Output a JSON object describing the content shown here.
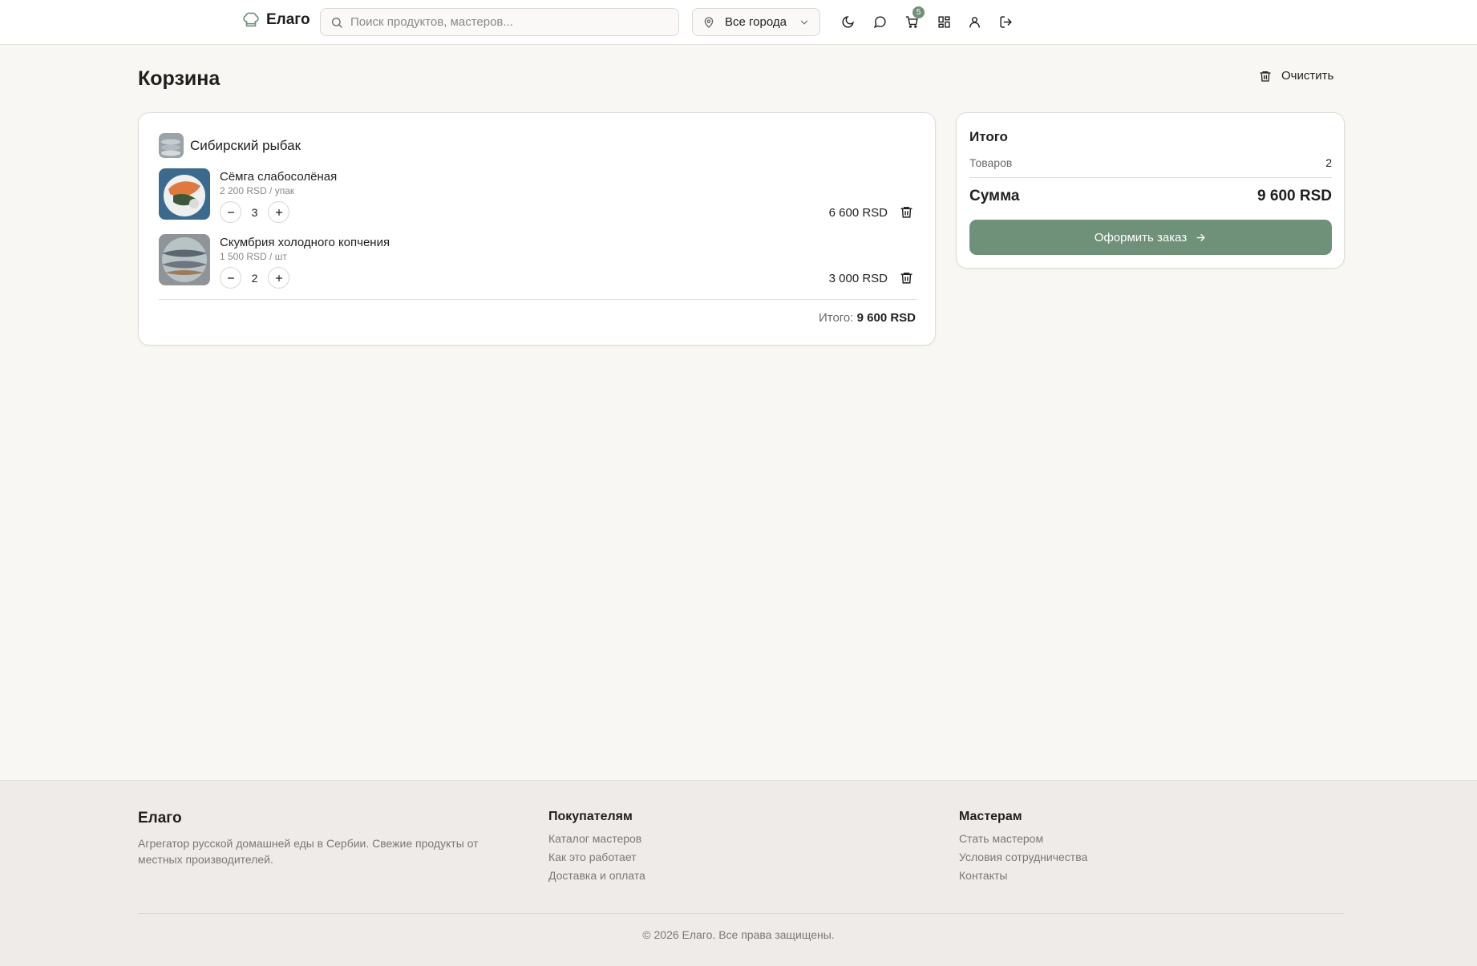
{
  "header": {
    "brand": "Елаго",
    "search_placeholder": "Поиск продуктов, мастеров...",
    "city": "Все города",
    "cart_count": "5"
  },
  "page": {
    "title": "Корзина",
    "clear_label": "Очистить"
  },
  "cart": {
    "seller": "Сибирский рыбак",
    "items": [
      {
        "name": "Сёмга слабосолёная",
        "unit_price": "2 200 RSD / упак",
        "qty": "3",
        "total": "6 600 RSD"
      },
      {
        "name": "Скумбрия холодного копчения",
        "unit_price": "1 500 RSD / шт",
        "qty": "2",
        "total": "3 000 RSD"
      }
    ],
    "total_label": "Итого:",
    "total_value": "9 600 RSD"
  },
  "summary": {
    "title": "Итого",
    "items_label": "Товаров",
    "items_value": "2",
    "sum_label": "Сумма",
    "sum_value": "9 600 RSD",
    "checkout_label": "Оформить заказ"
  },
  "footer": {
    "brand": "Елаго",
    "description": "Агрегатор русской домашней еды в Сербии. Свежие продукты от местных производителей.",
    "buyers_title": "Покупателям",
    "buyers_links": [
      "Каталог мастеров",
      "Как это работает",
      "Доставка и оплата"
    ],
    "masters_title": "Мастерам",
    "masters_links": [
      "Стать мастером",
      "Условия сотрудничества",
      "Контакты"
    ],
    "copyright": "© 2026 Елаго. Все права защищены."
  },
  "colors": {
    "accent": "#6f9079",
    "background": "#f8f7f4",
    "footer_bg": "#efebe8"
  }
}
